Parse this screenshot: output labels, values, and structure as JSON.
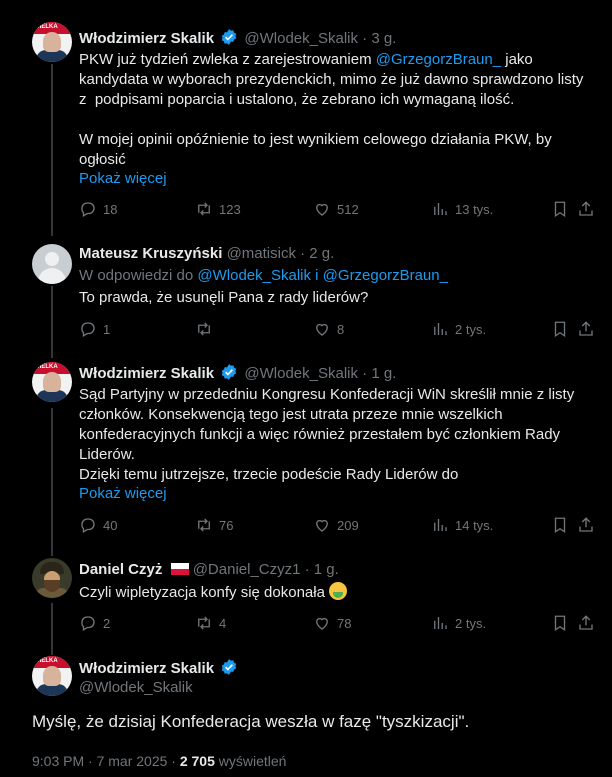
{
  "tweets": [
    {
      "name": "Włodzimierz Skalik",
      "handle_time": "@Wlodek_Skalik · 3 g.",
      "text_a": "PKW już tydzień zwleka z zarejestrowaniem ",
      "mention": "@GrzegorzBraun_",
      "text_b": " jako kandydata w wyborach prezydenckich, mimo że już dawno sprawdzono listy z  podpisami poparcia i ustalono, że zebrano ich wymaganą ilość.\n\nW mojej opinii opóźnienie to jest wynikiem celowego działania PKW, by ogłosić",
      "show_more": "Pokaż więcej",
      "replies": "18",
      "reposts": "123",
      "likes": "512",
      "views": "13 tys."
    },
    {
      "name": "Mateusz Kruszyński",
      "handle_time": "@matisick · 2 g.",
      "reply_prefix": "W odpowiedzi do ",
      "reply_to": "@Wlodek_Skalik i @GrzegorzBraun_",
      "text": "To prawda, że usunęli Pana z rady liderów?",
      "replies": "1",
      "reposts": "",
      "likes": "8",
      "views": "2 tys."
    },
    {
      "name": "Włodzimierz Skalik",
      "handle_time": "@Wlodek_Skalik · 1 g.",
      "text": "Sąd Partyjny w przededniu Kongresu Konfederacji WiN skreślił mnie z listy członków. Konsekwencją tego jest utrata przeze mnie wszelkich konfederacyjnych funkcji a więc również przestałem być członkiem Rady Liderów.\nDzięki temu jutrzejsze, trzecie podeście Rady Liderów do",
      "show_more": "Pokaż więcej",
      "replies": "40",
      "reposts": "76",
      "likes": "209",
      "views": "14 tys."
    },
    {
      "name": "Daniel Czyż",
      "handle_time": "@Daniel_Czyz1 · 1 g.",
      "text": "Czyli wipletyzacja konfy się dokonała",
      "replies": "2",
      "reposts": "4",
      "likes": "78",
      "views": "2 tys."
    }
  ],
  "main": {
    "name": "Włodzimierz Skalik",
    "handle": "@Wlodek_Skalik",
    "text": "Myślę, że dzisiaj Konfederacja weszła w fazę \"tyszkizacji\".",
    "time": "9:03 PM · 7 mar 2025 · ",
    "views_count": "2 705",
    "views_label": " wyświetleń"
  },
  "avatar_text": "WIELKA",
  "colors": {
    "accent": "#1d9bf0",
    "muted": "#71767b",
    "verified": "#1d9bf0"
  }
}
